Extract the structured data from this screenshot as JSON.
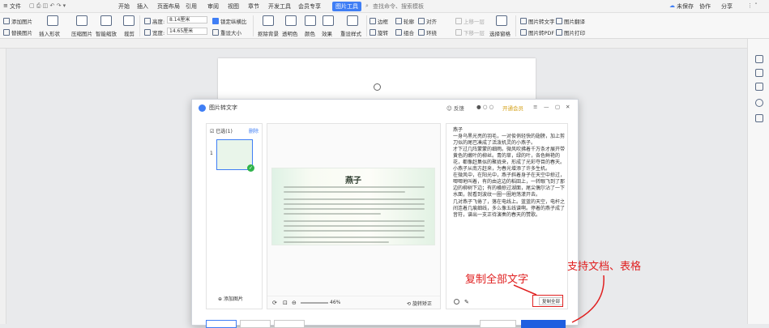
{
  "menubar": {
    "file": "文件",
    "items": [
      "开始",
      "插入",
      "页面布局",
      "引用",
      "审阅",
      "视图",
      "章节",
      "开发工具",
      "会员专享"
    ],
    "active_tab": "图片工具",
    "search": "查找命令、搜索模板",
    "right": [
      "未保存",
      "协作",
      "分享"
    ]
  },
  "ribbon": {
    "add_image": "添加图片",
    "replace_image": "替换图片",
    "insert_shape": "插入形状",
    "compress_image": "压缩图片",
    "smart_scale": "智能缩放",
    "crop": "裁剪",
    "height_label": "高度:",
    "height_value": "8.14厘米",
    "width_label": "宽度:",
    "width_value": "14.65厘米",
    "lock_ratio": "锁定纵横比",
    "reset_size": "重设大小",
    "remove_bg": "抠除背景",
    "transparent": "透明色",
    "color": "颜色",
    "effect": "效果",
    "reset_style": "重设样式",
    "border": "边框",
    "rotate": "旋转",
    "outline": "轮廓",
    "combine": "组合",
    "align": "对齐",
    "wrap": "环绕",
    "move_up": "上移一层",
    "move_down": "下移一层",
    "select_pane": "选择窗格",
    "img_to_text": "图片转文字",
    "img_translate": "图片翻译",
    "img_to_pdf": "图片转PDF",
    "img_print": "图片打印"
  },
  "dialog": {
    "title": "图片转文字",
    "feedback": "反馈",
    "vip": "开通会员",
    "selected": "已选(1)",
    "delete": "删除",
    "thumb_index": "1",
    "add_image": "添加图片",
    "zoom": "46%",
    "rotate_correct": "旋转矫正",
    "copy_all": "复制全部",
    "preview_title": "燕子"
  },
  "ocr_text": [
    "燕子",
    "一身乌黑光亮的羽毛，一对俊俏轻快的翅膀，加上剪刀似的尾巴凑成了活泼机灵的小燕子。",
    "才下过几阵蒙蒙的细雨。微风吹拂着千万条才展开带黄色的嫩叶的柳丝。青的草，绿的叶，各色鲜艳的花，都像赶集似的聚拢来，形成了光彩夺目的春天。小燕子从南方赶来，为春光增添了许多生机。",
    "在微风中，在阳光中，燕子斜着身子在天空中掠过，唧唧地叫着，有的由这边的稻田上，一转眼飞到了那边的柳树下边；有的横掠过湖面，尾尖偶尔沾了一下水面，就看到波纹一圈一圈地荡漾开去。",
    "几对燕子飞倦了，落在电线上。蓝蓝的天空，电杆之间连着几痕细线，多么像五线谱啊。停着的燕子成了音符，谱出一支正待演奏的春天的赞歌。"
  ],
  "annotations": {
    "copy_all_text": "复制全部文字",
    "support": "支持文档、表格"
  }
}
